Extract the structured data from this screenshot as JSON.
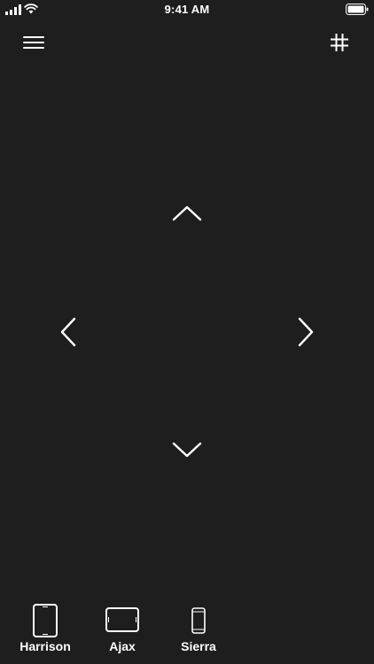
{
  "status_bar": {
    "time": "9:41 AM",
    "icons": [
      "signal-icon",
      "wifi-icon",
      "battery-icon"
    ]
  },
  "toolbar": {
    "left_icon": "hamburger-menu-icon",
    "right_icon": "hash-keypad-icon"
  },
  "dpad": {
    "up_icon": "chevron-up-icon",
    "down_icon": "chevron-down-icon",
    "left_icon": "chevron-left-icon",
    "right_icon": "chevron-right-icon"
  },
  "devices": [
    {
      "label": "Harrison",
      "icon": "tablet-portrait-icon"
    },
    {
      "label": "Ajax",
      "icon": "tablet-landscape-icon"
    },
    {
      "label": "Sierra",
      "icon": "phone-icon"
    }
  ],
  "colors": {
    "background": "#1e1e1e",
    "foreground": "#ffffff"
  }
}
